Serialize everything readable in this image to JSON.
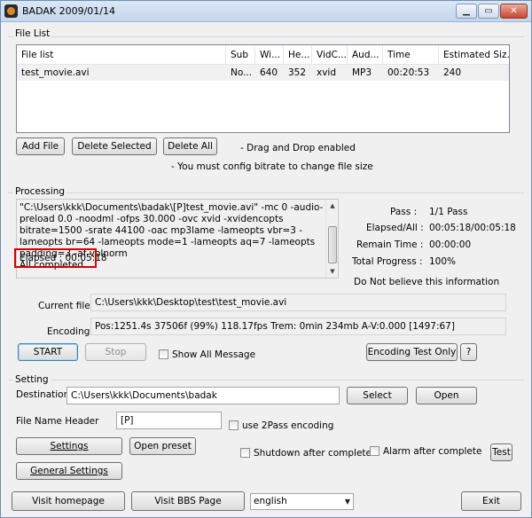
{
  "window": {
    "title": "BADAK 2009/01/14",
    "minimize_glyph": "▁",
    "maximize_glyph": "▭",
    "close_glyph": "✕"
  },
  "file_list": {
    "group_label": "File List",
    "columns": [
      "File list",
      "Sub",
      "Wi...",
      "He...",
      "VidC...",
      "Aud...",
      "Time",
      "Estimated Siz..."
    ],
    "rows": [
      [
        "test_movie.avi",
        "No...",
        "640",
        "352",
        "xvid",
        "MP3",
        "00:20:53",
        "240"
      ]
    ],
    "add_file": "Add File",
    "delete_selected": "Delete Selected",
    "delete_all": "Delete All",
    "note_drag": "- Drag and Drop enabled",
    "note_bitrate": "- You must config bitrate to change file size"
  },
  "processing": {
    "group_label": "Processing",
    "log_text": "\"C:\\Users\\kkk\\Documents\\badak\\[P]test_movie.avi\" -mc 0 -audio-preload 0.0 -noodml -ofps 30.000 -ovc xvid -xvidencopts bitrate=1500 -srate 44100 -oac mp3lame -lameopts vbr=3 -lameopts br=64 -lameopts mode=1 -lameopts aq=7 -lameopts padding=3 -af volnorm\nAll completed",
    "elapsed_line": "Elapsed : 00:05:18",
    "pass_label": "Pass :",
    "pass_value": "1/1 Pass",
    "elapsed_all_label": "Elapsed/All :",
    "elapsed_all_value": "00:05:18/00:05:18",
    "remain_label": "Remain Time :",
    "remain_value": "00:00:00",
    "total_label": "Total Progress :",
    "total_value": "100%",
    "note": "Do Not believe this information",
    "current_file_label": "Current file :",
    "current_file_value": "C:\\Users\\kkk\\Desktop\\test\\test_movie.avi",
    "encoding_label": "Encoding",
    "encoding_value": "Pos:1251.4s  37506f (99%) 118.17fps Trem:    0min 234mb  A-V:0.000 [1497:67]",
    "start": "START",
    "stop": "Stop",
    "show_all": "Show All Message",
    "show_all_checked": false,
    "encoding_test": "Encoding Test Only",
    "help": "?"
  },
  "setting": {
    "group_label": "Setting",
    "destination_label": "Destination",
    "destination_value": "C:\\Users\\kkk\\Documents\\badak",
    "select": "Select",
    "open": "Open",
    "file_name_header_label": "File Name Header",
    "file_name_header_value": "[P]",
    "use_2pass": "use 2Pass encoding",
    "use_2pass_checked": false,
    "settings": "Settings",
    "open_preset": "Open preset",
    "shutdown": "Shutdown after complete",
    "shutdown_checked": false,
    "alarm": "Alarm after complete",
    "alarm_checked": false,
    "test": "Test",
    "general_settings": "General Settings"
  },
  "footer": {
    "visit_homepage": "Visit homepage",
    "visit_bbs": "Visit BBS Page",
    "language_value": "english",
    "exit": "Exit"
  }
}
